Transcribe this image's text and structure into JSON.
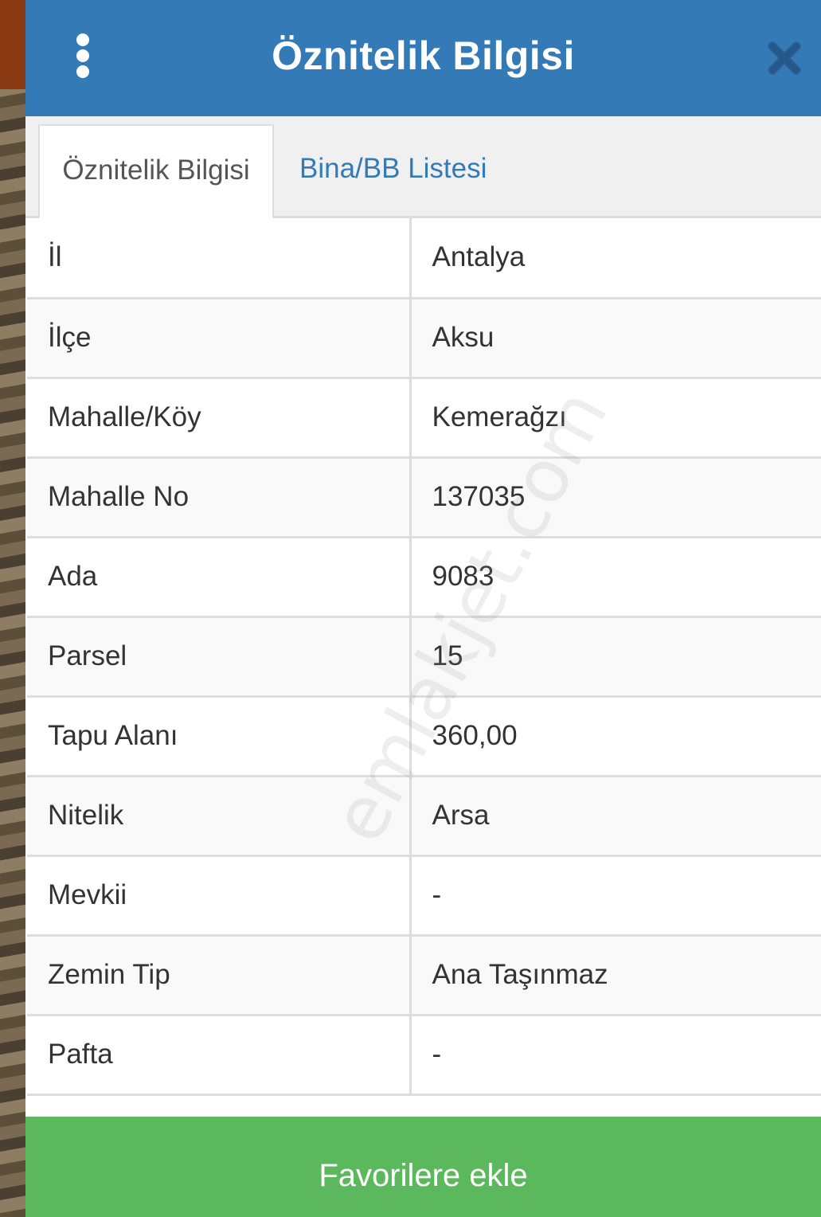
{
  "header": {
    "title": "Öznitelik Bilgisi",
    "menu_icon": "vertical-ellipsis-icon",
    "close_icon": "close-icon",
    "color": "#337ab7"
  },
  "tabs": [
    {
      "label": "Öznitelik Bilgisi",
      "active": true
    },
    {
      "label": "Bina/BB Listesi",
      "active": false
    }
  ],
  "attributes": [
    {
      "key": "İl",
      "value": "Antalya"
    },
    {
      "key": "İlçe",
      "value": "Aksu"
    },
    {
      "key": "Mahalle/Köy",
      "value": "Kemerağzı"
    },
    {
      "key": "Mahalle No",
      "value": "137035"
    },
    {
      "key": "Ada",
      "value": "9083"
    },
    {
      "key": "Parsel",
      "value": "15"
    },
    {
      "key": "Tapu Alanı",
      "value": "360,00"
    },
    {
      "key": "Nitelik",
      "value": "Arsa"
    },
    {
      "key": "Mevkii",
      "value": "-"
    },
    {
      "key": "Zemin Tip",
      "value": "Ana Taşınmaz"
    },
    {
      "key": "Pafta",
      "value": "-"
    }
  ],
  "watermark": "emlakjet.com",
  "footer": {
    "button_label": "Favorilere ekle",
    "color": "#5cb85c"
  }
}
